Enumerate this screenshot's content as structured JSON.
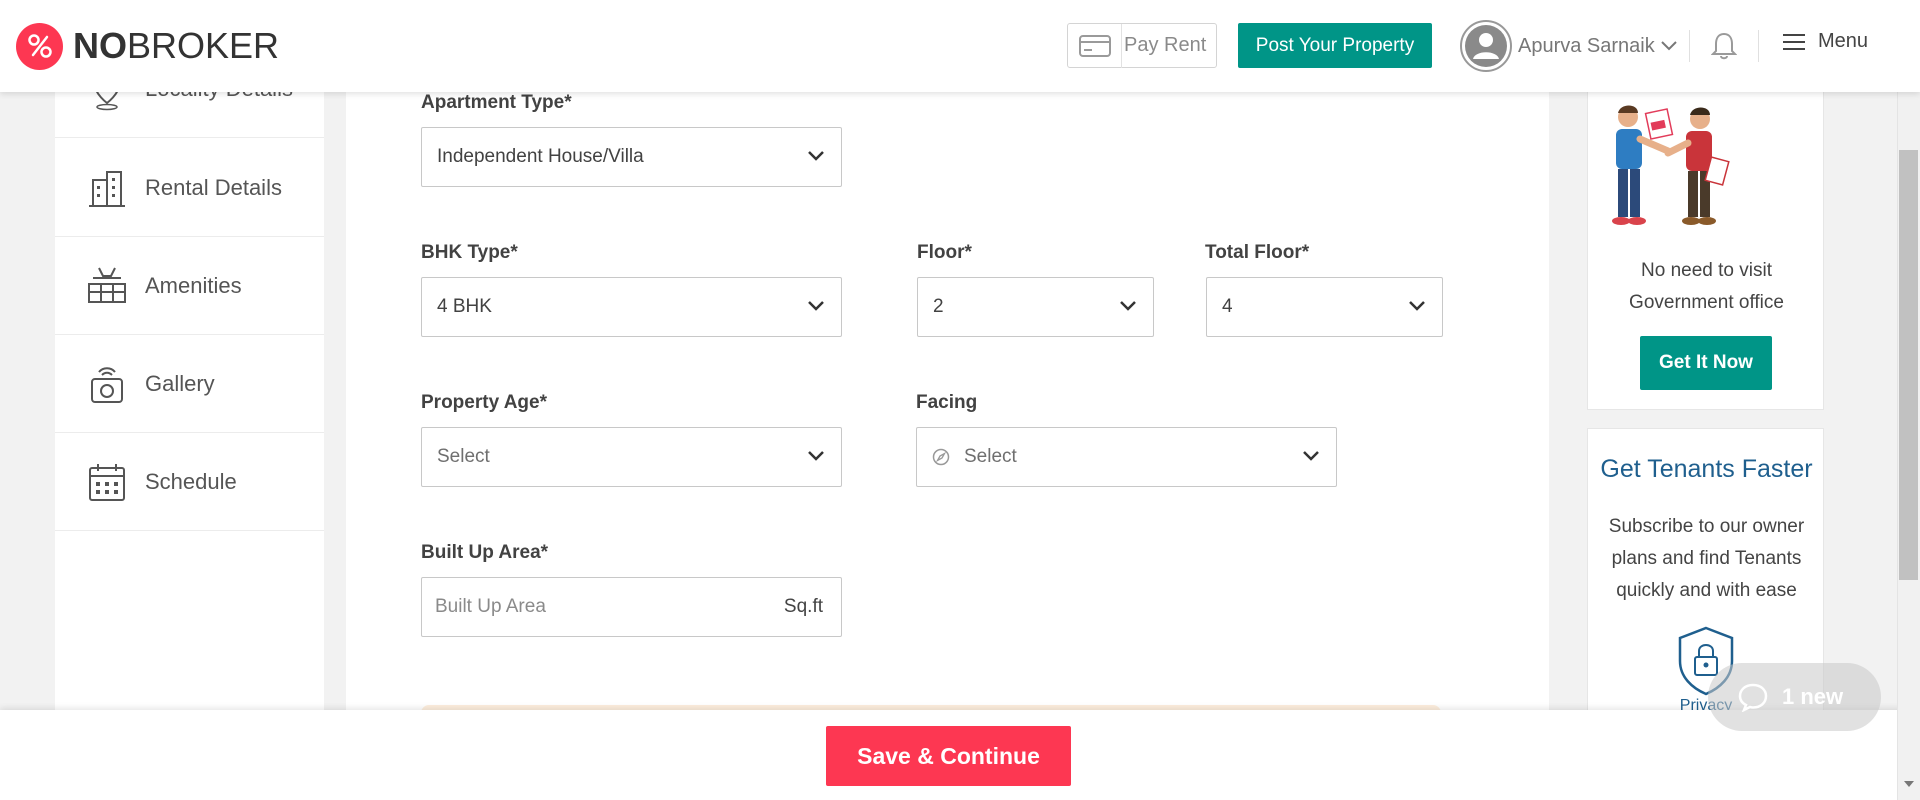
{
  "header": {
    "logo_bold": "NO",
    "logo_rest": "BROKER",
    "pay_rent_label": "Pay Rent",
    "post_property_label": "Post Your Property",
    "user_name": "Apurva Sarnaik",
    "menu_label": "Menu"
  },
  "sidebar": {
    "items": [
      {
        "label": "Locality Details",
        "icon": "location-pin-icon"
      },
      {
        "label": "Rental Details",
        "icon": "building-icon"
      },
      {
        "label": "Amenities",
        "icon": "amenities-icon"
      },
      {
        "label": "Gallery",
        "icon": "camera-icon"
      },
      {
        "label": "Schedule",
        "icon": "calendar-icon"
      }
    ]
  },
  "form": {
    "apartment_type": {
      "label": "Apartment Type*",
      "value": "Independent House/Villa"
    },
    "bhk_type": {
      "label": "BHK Type*",
      "value": "4 BHK"
    },
    "floor": {
      "label": "Floor*",
      "value": "2"
    },
    "total_floor": {
      "label": "Total Floor*",
      "value": "4"
    },
    "property_age": {
      "label": "Property Age*",
      "value": "Select"
    },
    "facing": {
      "label": "Facing",
      "value": "Select"
    },
    "built_up_area": {
      "label": "Built Up Area*",
      "placeholder": "Built Up Area",
      "suffix": "Sq.ft"
    }
  },
  "promo": {
    "line1": "No need to visit",
    "line2": "Government office",
    "button_label": "Get It Now"
  },
  "tenants": {
    "title": "Get Tenants Faster",
    "text": "Subscribe to our owner plans and find Tenants quickly and with ease",
    "privacy_label": "Privacy"
  },
  "chat": {
    "label": "1 new"
  },
  "footer": {
    "save_label": "Save & Continue"
  },
  "colors": {
    "brand_red": "#fd3752",
    "teal": "#009587",
    "blue_title": "#1f5f8e"
  }
}
